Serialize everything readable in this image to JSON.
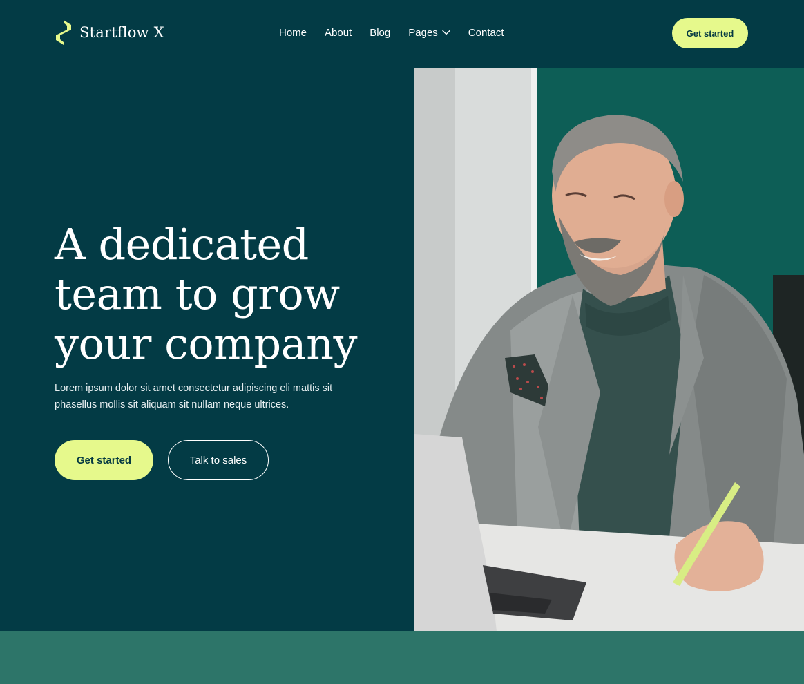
{
  "brand": {
    "name": "Startflow X",
    "accent_color": "#e6f98c",
    "background_color": "#033b45",
    "logo_icon": "s-logo-icon"
  },
  "nav": {
    "items": [
      {
        "label": "Home"
      },
      {
        "label": "About"
      },
      {
        "label": "Blog"
      },
      {
        "label": "Pages",
        "icon": "chevron-down-icon"
      },
      {
        "label": "Contact"
      }
    ],
    "cta_label": "Get started"
  },
  "hero": {
    "title_lines": [
      "A dedicated",
      "team to grow",
      "your company"
    ],
    "subtitle": "Lorem ipsum dolor sit amet consectetur adipiscing eli mattis sit phasellus mollis sit aliquam sit nullam neque ultrices.",
    "primary_button": "Get started",
    "secondary_button": "Talk to sales"
  },
  "band": {
    "color": "#2d7569"
  }
}
